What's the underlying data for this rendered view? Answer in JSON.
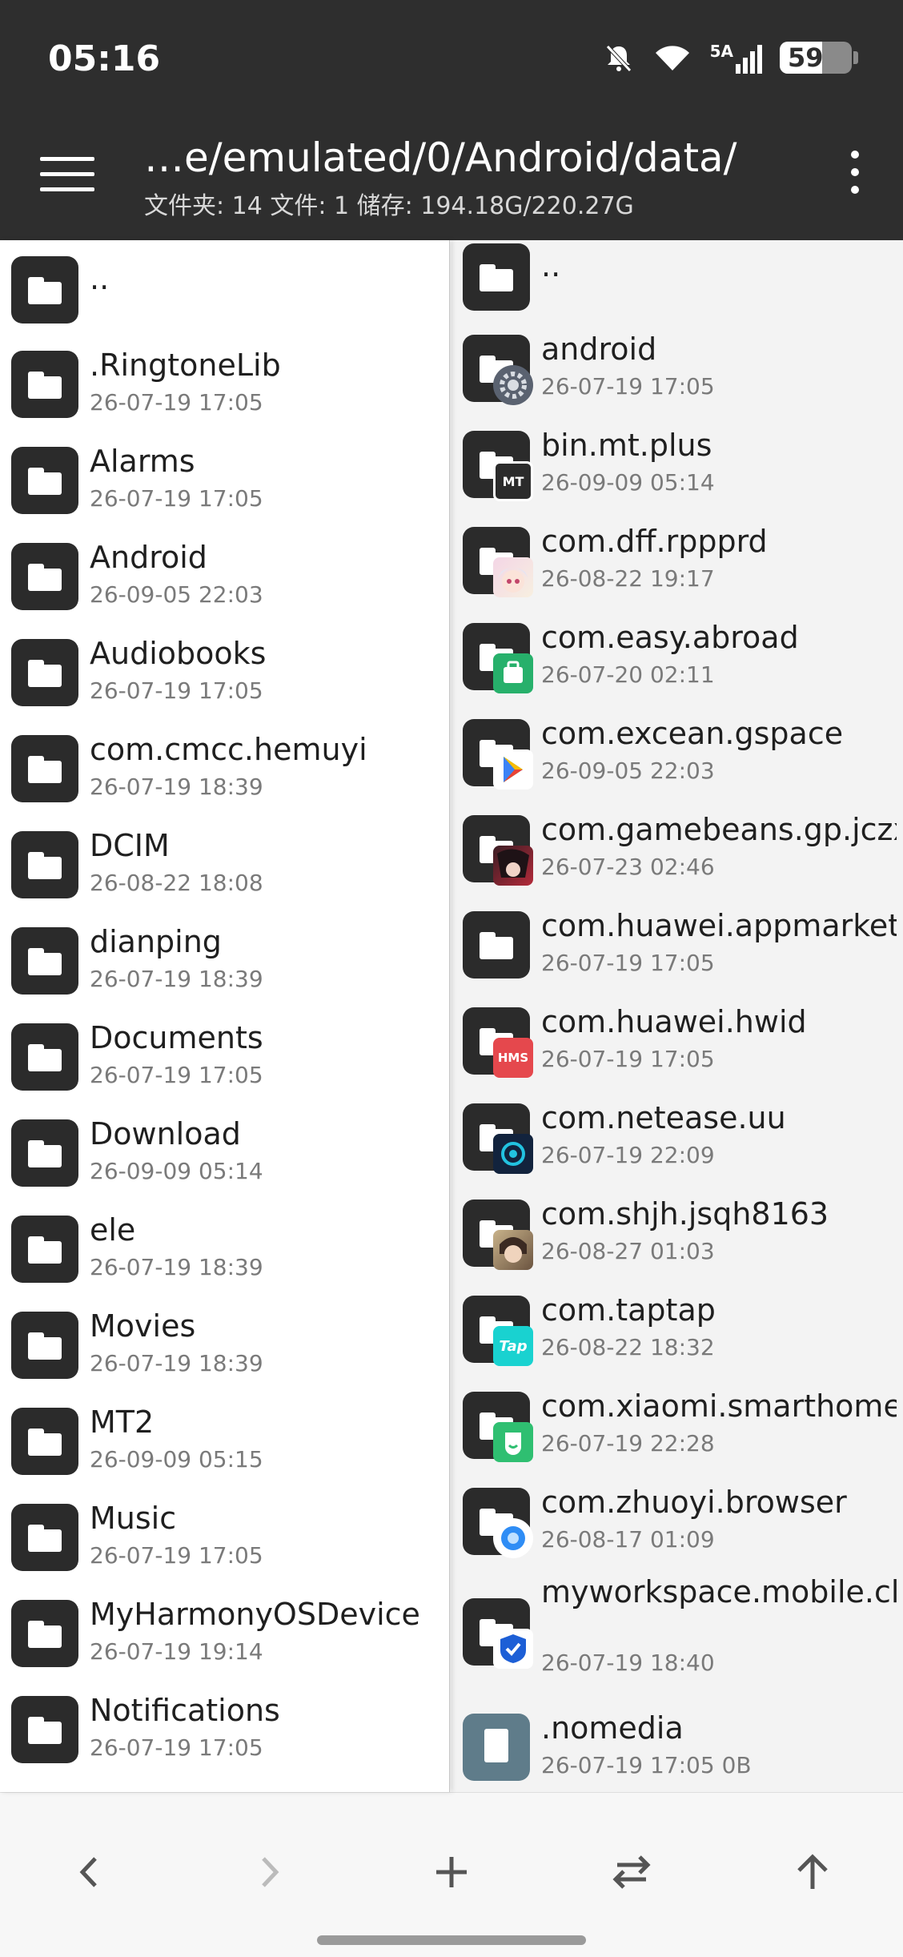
{
  "status": {
    "time": "05:16",
    "network": "5A",
    "battery": "59"
  },
  "header": {
    "path": "…e/emulated/0/Android/data/",
    "info": "文件夹: 14  文件: 1  储存: 194.18G/220.27G"
  },
  "left_pane": {
    "up": "..",
    "items": [
      {
        "name": ".RingtoneLib",
        "meta": "26-07-19 17:05"
      },
      {
        "name": "Alarms",
        "meta": "26-07-19 17:05"
      },
      {
        "name": "Android",
        "meta": "26-09-05 22:03"
      },
      {
        "name": "Audiobooks",
        "meta": "26-07-19 17:05"
      },
      {
        "name": "com.cmcc.hemuyi",
        "meta": "26-07-19 18:39"
      },
      {
        "name": "DCIM",
        "meta": "26-08-22 18:08"
      },
      {
        "name": "dianping",
        "meta": "26-07-19 18:39"
      },
      {
        "name": "Documents",
        "meta": "26-07-19 17:05"
      },
      {
        "name": "Download",
        "meta": "26-09-09 05:14"
      },
      {
        "name": "ele",
        "meta": "26-07-19 18:39"
      },
      {
        "name": "Movies",
        "meta": "26-07-19 18:39"
      },
      {
        "name": "MT2",
        "meta": "26-09-09 05:15"
      },
      {
        "name": "Music",
        "meta": "26-07-19 17:05"
      },
      {
        "name": "MyHarmonyOSDevice",
        "meta": "26-07-19 19:14"
      },
      {
        "name": "Notifications",
        "meta": "26-07-19 17:05"
      }
    ]
  },
  "right_pane": {
    "up": "..",
    "items": [
      {
        "name": "android",
        "meta": "26-07-19 17:05",
        "badge": "settings-badge"
      },
      {
        "name": "bin.mt.plus",
        "meta": "26-09-09 05:14",
        "badge": "mt-badge",
        "badge_text": "MT"
      },
      {
        "name": "com.dff.rppprd",
        "meta": "26-08-22 19:17",
        "badge": "anime-avatar-badge"
      },
      {
        "name": "com.easy.abroad",
        "meta": "26-07-20 02:11",
        "badge": "bag-badge"
      },
      {
        "name": "com.excean.gspace",
        "meta": "26-09-05 22:03",
        "badge": "play-store-badge"
      },
      {
        "name": "com.gamebeans.gp.jczx",
        "meta": "26-07-23 02:46",
        "badge": "game-character-badge"
      },
      {
        "name": "com.huawei.appmarket",
        "meta": "26-07-19 17:05"
      },
      {
        "name": "com.huawei.hwid",
        "meta": "26-07-19 17:05",
        "badge": "hms-badge",
        "badge_text": "HMS"
      },
      {
        "name": "com.netease.uu",
        "meta": "26-07-19 22:09",
        "badge": "uu-badge"
      },
      {
        "name": "com.shjh.jsqh8163",
        "meta": "26-08-27 01:03",
        "badge": "character-badge"
      },
      {
        "name": "com.taptap",
        "meta": "26-08-22 18:32",
        "badge": "taptap-badge",
        "badge_text": "Tap"
      },
      {
        "name": "com.xiaomi.smarthome",
        "meta": "26-07-19 22:28",
        "badge": "mi-home-badge"
      },
      {
        "name": "com.zhuoyi.browser",
        "meta": "26-08-17 01:09",
        "badge": "browser-badge"
      },
      {
        "name": "myworkspace.mobile.clients.android",
        "meta": "26-07-19 18:40",
        "badge": "workspace-badge"
      },
      {
        "name": ".nomedia",
        "meta": "26-07-19 17:05  0B",
        "type": "file"
      }
    ]
  },
  "colors": {
    "bar": "#2e2e2e",
    "folder": "#2b2b2b",
    "file": "#5f7c8a"
  },
  "bottom_nav": {
    "back": "‹",
    "forward": "›",
    "add": "+",
    "swap": "⇄",
    "up": "↑"
  }
}
